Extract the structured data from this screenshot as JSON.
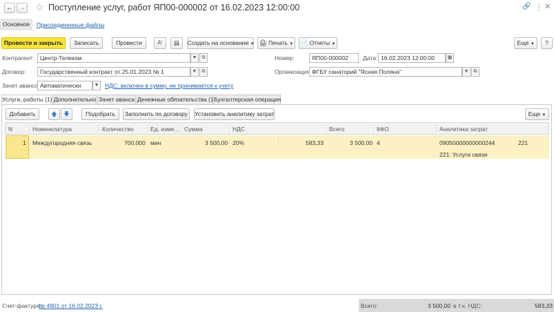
{
  "window": {
    "title": "Поступление услуг, работ ЯП00-000002 от 16.02.2023 12:00:00"
  },
  "nav": {
    "main_link": "Основное",
    "files_link": "Присоединенные файлы"
  },
  "toolbar": {
    "post_close": "Провести и закрыть",
    "save": "Записать",
    "post": "Провести",
    "create_based": "Создать на основании",
    "print": "Печать",
    "reports": "Отчеты",
    "more": "Еще",
    "help": "?"
  },
  "form": {
    "counterparty_label": "Контрагент:",
    "counterparty_value": "Центр-Телеком",
    "contract_label": "Договор:",
    "contract_value": "Государственный контракт от 25.01.2023 № 1",
    "advance_label": "Зачет аванса:",
    "advance_value": "Автоматически",
    "vat_link": "НДС: включен в сумму, не принимается к учету",
    "number_label": "Номер:",
    "number_value": "ЯП00-000002",
    "date_label": "Дата:",
    "date_value": "16.02.2023 12:00:00",
    "org_label": "Организация:",
    "org_value": "ФГБУ санаторий \"Ясная Поляна\""
  },
  "tabs": [
    {
      "label": "Услуги, работы (1)"
    },
    {
      "label": "Дополнительно"
    },
    {
      "label": "Зачет аванса"
    },
    {
      "label": "Денежные обязательства (1)"
    },
    {
      "label": "Бухгалтерская операция"
    }
  ],
  "table_toolbar": {
    "add": "Добавить",
    "pick": "Подобрать",
    "fill": "Заполнить по договору",
    "set_analytics": "Установить аналитику затрат",
    "more": "Еще"
  },
  "table": {
    "headers": {
      "n": "N",
      "item": "Номенклатура",
      "qty": "Количество",
      "unit": "Ед. изме...",
      "sum": "Сумма",
      "vat": "НДС",
      "total": "Всего",
      "kfo": "КФО",
      "analytics": "Аналитика затрат"
    },
    "rows": [
      {
        "n": "1",
        "item": "Междугородняя связь",
        "qty": "700,000",
        "unit": "мин",
        "sum": "3 500,00",
        "vat_rate": "20%",
        "vat_sum": "583,33",
        "total": "3 500,00",
        "kfo": "4",
        "analytics_code": "09050000000000244",
        "analytics_kosgu": "221",
        "analytics_desc": "221: Услуги связи"
      }
    ]
  },
  "footer": {
    "invoice_label": "Счет-фактура:",
    "invoice_link": "№ 4901 от 16.02.2023 г.",
    "total_label": "Всего:",
    "total_value": "3 500,00",
    "vat_label": "в т.ч. НДС:",
    "vat_value": "583,33"
  },
  "colors": {
    "accent_button": "#f9e33a",
    "selected_row": "#fbf1c4",
    "link": "#1c5fa8",
    "footer_bar": "#d9d9d9"
  }
}
